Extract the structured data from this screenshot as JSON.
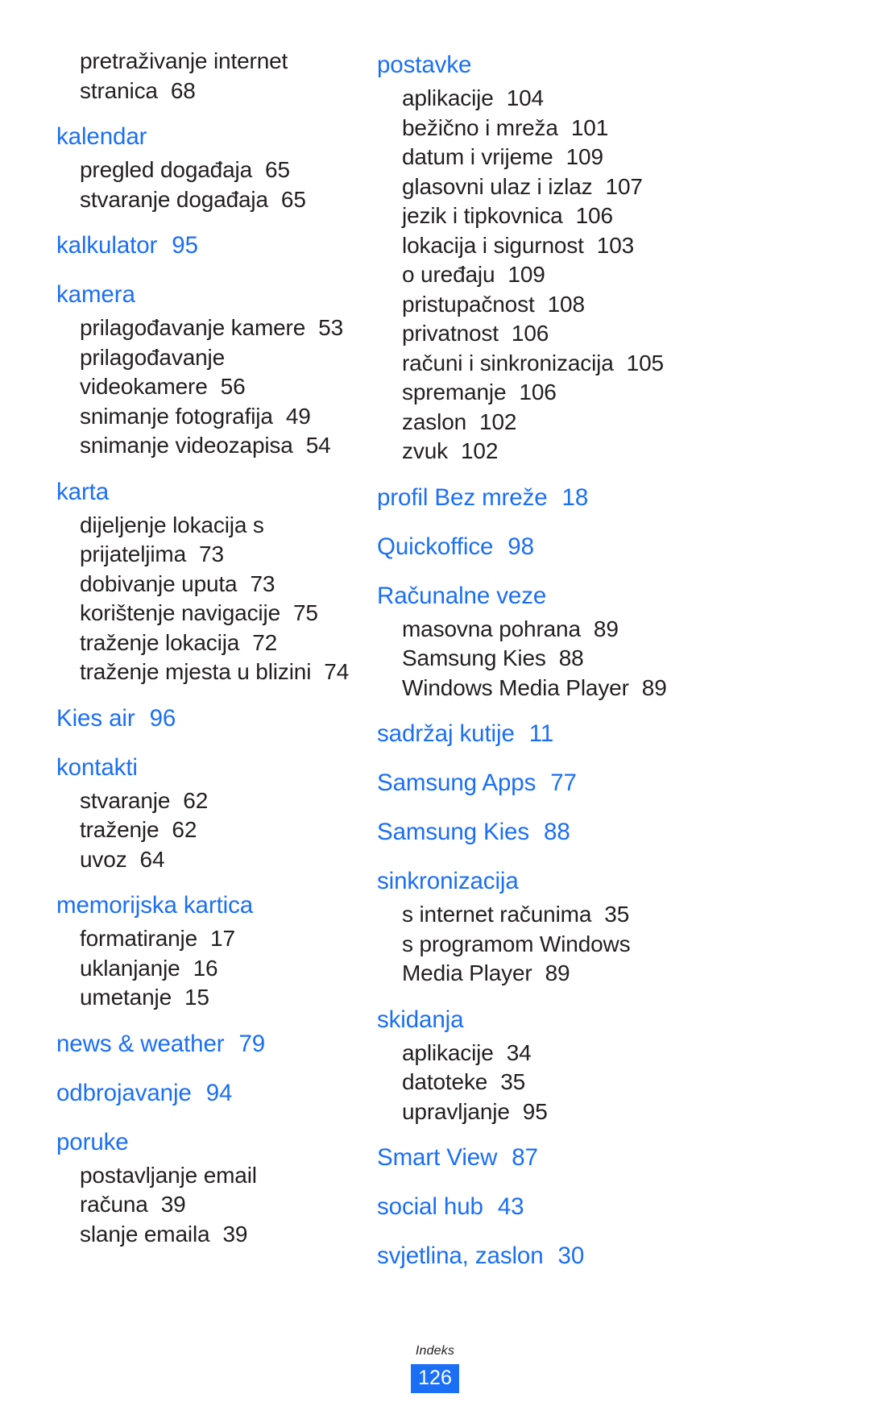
{
  "document": {
    "footer_label": "Indeks",
    "page_number": "126",
    "accent_color": "#1b6ff5",
    "text_color": "#231f20"
  },
  "left_column": [
    {
      "heading": "",
      "page": "",
      "subs": [
        {
          "text": "pretraživanje internet",
          "page": ""
        },
        {
          "text": "stranica",
          "page": "68"
        }
      ]
    },
    {
      "heading": "kalendar",
      "page": "",
      "subs": [
        {
          "text": "pregled događaja",
          "page": "65"
        },
        {
          "text": "stvaranje događaja",
          "page": "65"
        }
      ]
    },
    {
      "heading": "kalkulator",
      "page": "95",
      "subs": []
    },
    {
      "heading": "kamera",
      "page": "",
      "subs": [
        {
          "text": "prilagođavanje kamere",
          "page": "53"
        },
        {
          "text": "prilagođavanje",
          "page": ""
        },
        {
          "text": "videokamere",
          "page": "56"
        },
        {
          "text": "snimanje fotografija",
          "page": "49"
        },
        {
          "text": "snimanje videozapisa",
          "page": "54"
        }
      ]
    },
    {
      "heading": "karta",
      "page": "",
      "subs": [
        {
          "text": "dijeljenje lokacija s",
          "page": ""
        },
        {
          "text": "prijateljima",
          "page": "73"
        },
        {
          "text": "dobivanje uputa",
          "page": "73"
        },
        {
          "text": "korištenje navigacije",
          "page": "75"
        },
        {
          "text": "traženje lokacija",
          "page": "72"
        },
        {
          "text": "traženje mjesta u blizini",
          "page": "74"
        }
      ]
    },
    {
      "heading": "Kies air",
      "page": "96",
      "subs": []
    },
    {
      "heading": "kontakti",
      "page": "",
      "subs": [
        {
          "text": "stvaranje",
          "page": "62"
        },
        {
          "text": "traženje",
          "page": "62"
        },
        {
          "text": "uvoz",
          "page": "64"
        }
      ]
    },
    {
      "heading": "memorijska kartica",
      "page": "",
      "subs": [
        {
          "text": "formatiranje",
          "page": "17"
        },
        {
          "text": "uklanjanje",
          "page": "16"
        },
        {
          "text": "umetanje",
          "page": "15"
        }
      ]
    },
    {
      "heading": "news & weather",
      "page": "79",
      "subs": []
    },
    {
      "heading": "odbrojavanje",
      "page": "94",
      "subs": []
    },
    {
      "heading": "poruke",
      "page": "",
      "subs": [
        {
          "text": "postavljanje email",
          "page": ""
        },
        {
          "text": "računa",
          "page": "39"
        },
        {
          "text": "slanje emaila",
          "page": "39"
        }
      ]
    }
  ],
  "right_column": [
    {
      "heading": "postavke",
      "page": "",
      "subs": [
        {
          "text": "aplikacije",
          "page": "104"
        },
        {
          "text": "bežično i mreža",
          "page": "101"
        },
        {
          "text": "datum i vrijeme",
          "page": "109"
        },
        {
          "text": "glasovni ulaz i izlaz",
          "page": "107"
        },
        {
          "text": "jezik i tipkovnica",
          "page": "106"
        },
        {
          "text": "lokacija i sigurnost",
          "page": "103"
        },
        {
          "text": "o uređaju",
          "page": "109"
        },
        {
          "text": "pristupačnost",
          "page": "108"
        },
        {
          "text": "privatnost",
          "page": "106"
        },
        {
          "text": "računi i sinkronizacija",
          "page": "105"
        },
        {
          "text": "spremanje",
          "page": "106"
        },
        {
          "text": "zaslon",
          "page": "102"
        },
        {
          "text": "zvuk",
          "page": "102"
        }
      ]
    },
    {
      "heading": "profil Bez mreže",
      "page": "18",
      "subs": []
    },
    {
      "heading": "Quickoffice",
      "page": "98",
      "subs": []
    },
    {
      "heading": "Računalne veze",
      "page": "",
      "subs": [
        {
          "text": "masovna pohrana",
          "page": "89"
        },
        {
          "text": "Samsung Kies",
          "page": "88"
        },
        {
          "text": "Windows Media Player",
          "page": "89"
        }
      ]
    },
    {
      "heading": "sadržaj kutije",
      "page": "11",
      "subs": []
    },
    {
      "heading": "Samsung Apps",
      "page": "77",
      "subs": []
    },
    {
      "heading": "Samsung Kies",
      "page": "88",
      "subs": []
    },
    {
      "heading": "sinkronizacija",
      "page": "",
      "subs": [
        {
          "text": "s internet računima",
          "page": "35"
        },
        {
          "text": "s programom Windows",
          "page": ""
        },
        {
          "text": "Media Player",
          "page": "89"
        }
      ]
    },
    {
      "heading": "skidanja",
      "page": "",
      "subs": [
        {
          "text": "aplikacije",
          "page": "34"
        },
        {
          "text": "datoteke",
          "page": "35"
        },
        {
          "text": "upravljanje",
          "page": "95"
        }
      ]
    },
    {
      "heading": "Smart View",
      "page": "87",
      "subs": []
    },
    {
      "heading": "social hub",
      "page": "43",
      "subs": []
    },
    {
      "heading": "svjetlina, zaslon",
      "page": "30",
      "subs": []
    }
  ]
}
